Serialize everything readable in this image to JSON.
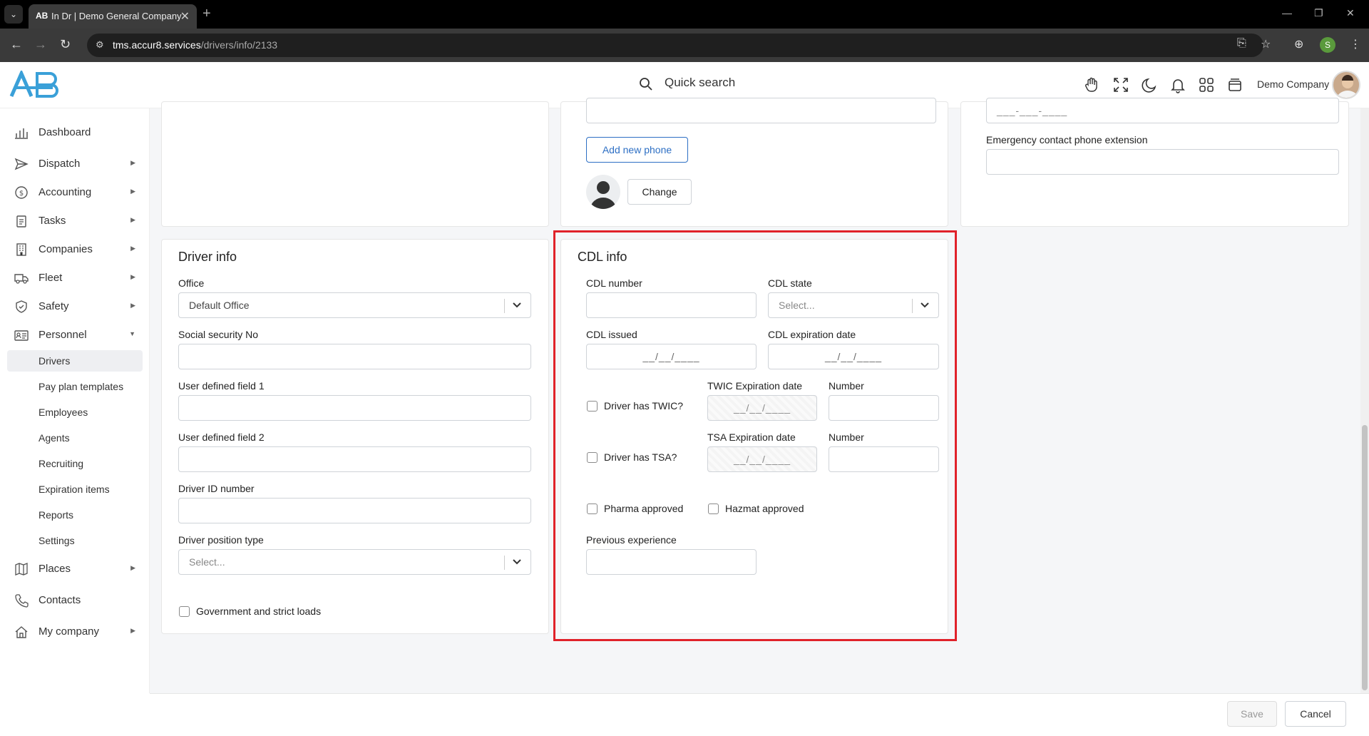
{
  "browser": {
    "tab_favicon": "AB",
    "tab_title": "In Dr | Demo General Company",
    "url_host": "tms.accur8.services",
    "url_path": "/drivers/info/2133",
    "profile_initial": "S"
  },
  "header": {
    "quick_search": "Quick search",
    "company": "Demo Company"
  },
  "sidebar": {
    "items": [
      {
        "label": "Dashboard",
        "icon": "chart-icon"
      },
      {
        "label": "Dispatch",
        "icon": "send-icon"
      },
      {
        "label": "Accounting",
        "icon": "dollar-icon"
      },
      {
        "label": "Tasks",
        "icon": "clipboard-icon"
      },
      {
        "label": "Companies",
        "icon": "building-icon"
      },
      {
        "label": "Fleet",
        "icon": "truck-icon"
      },
      {
        "label": "Safety",
        "icon": "shield-icon"
      },
      {
        "label": "Personnel",
        "icon": "id-card-icon"
      }
    ],
    "personnel_sub": [
      "Drivers",
      "Pay plan templates",
      "Employees",
      "Agents",
      "Recruiting",
      "Expiration items",
      "Reports",
      "Settings"
    ],
    "bottom_items": [
      {
        "label": "Places",
        "icon": "map-icon"
      },
      {
        "label": "Contacts",
        "icon": "phone-icon"
      },
      {
        "label": "My company",
        "icon": "home-icon"
      }
    ]
  },
  "top_cards": {
    "phone_placeholder": "___-___-____",
    "add_phone": "Add new phone",
    "change": "Change",
    "emergency_ext_label": "Emergency contact phone extension"
  },
  "driver_info": {
    "title": "Driver info",
    "office_label": "Office",
    "office_value": "Default Office",
    "ssn_label": "Social security No",
    "udf1_label": "User defined field 1",
    "udf2_label": "User defined field 2",
    "driver_id_label": "Driver ID number",
    "position_label": "Driver position type",
    "position_placeholder": "Select...",
    "gov_loads_label": "Government and strict loads"
  },
  "cdl_info": {
    "title": "CDL info",
    "cdl_number_label": "CDL number",
    "cdl_state_label": "CDL state",
    "cdl_state_placeholder": "Select...",
    "cdl_issued_label": "CDL issued",
    "cdl_exp_label": "CDL expiration date",
    "date_mask": "__/__/____",
    "twic_check_label": "Driver has TWIC?",
    "twic_exp_label": "TWIC Expiration date",
    "twic_number_label": "Number",
    "tsa_check_label": "Driver has TSA?",
    "tsa_exp_label": "TSA Expiration date",
    "tsa_number_label": "Number",
    "pharma_label": "Pharma approved",
    "hazmat_label": "Hazmat approved",
    "prev_exp_label": "Previous experience"
  },
  "footer": {
    "save": "Save",
    "cancel": "Cancel"
  }
}
